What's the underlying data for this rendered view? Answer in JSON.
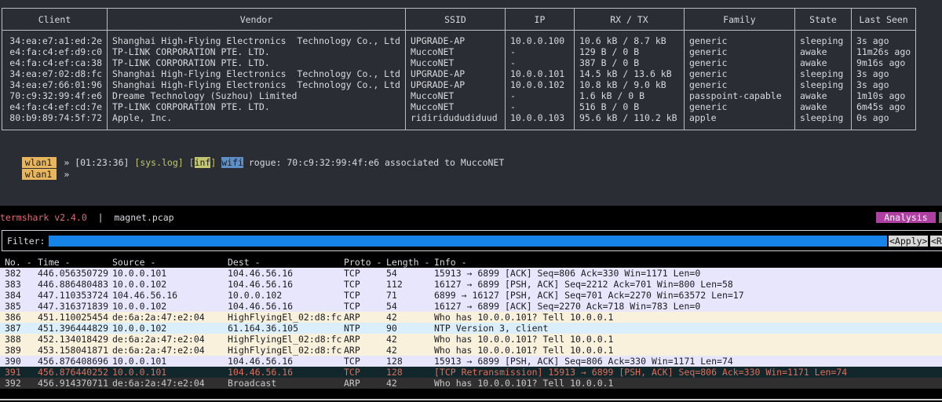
{
  "clients_table": {
    "headers": [
      "Client",
      "Vendor",
      "SSID",
      "IP",
      "RX / TX",
      "Family",
      "State",
      "Last Seen"
    ],
    "rows": [
      [
        "34:ea:e7:a1:ed:2e",
        "Shanghai High-Flying Electronics  Technology Co., Ltd",
        "UPGRADE-AP",
        "10.0.0.100",
        "10.6 kB / 8.7 kB",
        "generic",
        "sleeping",
        "3s ago"
      ],
      [
        "e4:fa:c4:ef:d9:c0",
        "TP-LINK CORPORATION PTE. LTD.",
        "MuccoNET",
        "-",
        "129 B / 0 B",
        "generic",
        "awake",
        "11m26s ago"
      ],
      [
        "e4:fa:c4:ef:ca:38",
        "TP-LINK CORPORATION PTE. LTD.",
        "MuccoNET",
        "-",
        "387 B / 0 B",
        "generic",
        "awake",
        "9m16s ago"
      ],
      [
        "34:ea:e7:02:d8:fc",
        "Shanghai High-Flying Electronics  Technology Co., Ltd",
        "UPGRADE-AP",
        "10.0.0.101",
        "14.5 kB / 13.6 kB",
        "generic",
        "sleeping",
        "3s ago"
      ],
      [
        "34:ea:e7:66:01:96",
        "Shanghai High-Flying Electronics  Technology Co., Ltd",
        "UPGRADE-AP",
        "10.0.0.102",
        "10.8 kB / 9.0 kB",
        "generic",
        "sleeping",
        "3s ago"
      ],
      [
        "70:c9:32:99:4f:e6",
        "Dreame Technology (Suzhou) Limited",
        "MuccoNET",
        "-",
        "1.6 kB / 0 B",
        "passpoint-capable",
        "awake",
        "1m10s ago"
      ],
      [
        "e4:fa:c4:ef:cd:7e",
        "TP-LINK CORPORATION PTE. LTD.",
        "MuccoNET",
        "-",
        "516 B / 0 B",
        "generic",
        "awake",
        "6m45s ago"
      ],
      [
        "80:b9:89:74:5f:72",
        "Apple, Inc.",
        "ridiridududiduud",
        "10.0.0.103",
        "95.6 kB / 110.2 kB",
        "apple",
        "sleeping",
        "0s ago"
      ]
    ]
  },
  "prompt": {
    "iface": "wlan1",
    "chevron": "»",
    "time": "[01:23:36]",
    "syslog_tag": "[sys.log]",
    "bracket_open": "[",
    "level": "inf",
    "bracket_close": "]",
    "module": "wifi",
    "message": "rogue: 70:c9:32:99:4f:e6 associated to MuccoNET"
  },
  "termshark": {
    "app_name": "termshark v2.4.0",
    "separator": "|",
    "file_name": "magnet.pcap",
    "analysis_label": "Analysis",
    "filter_label": "Filter:",
    "filter_value": "",
    "apply_label": "<Apply>",
    "recent_label": "<Recent>",
    "columns": [
      "No. -",
      "Time -",
      "Source -",
      "Dest -",
      "Proto -",
      "Length -",
      "Info -"
    ],
    "packets": [
      {
        "no": "382",
        "time": "446.056350729",
        "src": "10.0.0.101",
        "dst": "104.46.56.16",
        "proto": "TCP",
        "len": "54",
        "info": "15913 → 6899 [ACK] Seq=806 Ack=330 Win=1171 Len=0",
        "kind": "tcp"
      },
      {
        "no": "383",
        "time": "446.886480483",
        "src": "10.0.0.102",
        "dst": "104.46.56.16",
        "proto": "TCP",
        "len": "112",
        "info": "16127 → 6899 [PSH, ACK] Seq=2212 Ack=701 Win=800 Len=58",
        "kind": "tcp"
      },
      {
        "no": "384",
        "time": "447.110353724",
        "src": "104.46.56.16",
        "dst": "10.0.0.102",
        "proto": "TCP",
        "len": "71",
        "info": "6899 → 16127 [PSH, ACK] Seq=701 Ack=2270 Win=63572 Len=17",
        "kind": "tcp"
      },
      {
        "no": "385",
        "time": "447.316371839",
        "src": "10.0.0.102",
        "dst": "104.46.56.16",
        "proto": "TCP",
        "len": "54",
        "info": "16127 → 6899 [ACK] Seq=2270 Ack=718 Win=783 Len=0",
        "kind": "tcp"
      },
      {
        "no": "386",
        "time": "451.110025454",
        "src": "de:6a:2a:47:e2:04",
        "dst": "HighFlyingEl_02:d8:fc",
        "proto": "ARP",
        "len": "42",
        "info": "Who has 10.0.0.101? Tell 10.0.0.1",
        "kind": "arp"
      },
      {
        "no": "387",
        "time": "451.396444829",
        "src": "10.0.0.102",
        "dst": "61.164.36.105",
        "proto": "NTP",
        "len": "90",
        "info": "NTP Version 3, client",
        "kind": "ntp"
      },
      {
        "no": "388",
        "time": "452.134018429",
        "src": "de:6a:2a:47:e2:04",
        "dst": "HighFlyingEl_02:d8:fc",
        "proto": "ARP",
        "len": "42",
        "info": "Who has 10.0.0.101? Tell 10.0.0.1",
        "kind": "arp"
      },
      {
        "no": "389",
        "time": "453.158041871",
        "src": "de:6a:2a:47:e2:04",
        "dst": "HighFlyingEl_02:d8:fc",
        "proto": "ARP",
        "len": "42",
        "info": "Who has 10.0.0.101? Tell 10.0.0.1",
        "kind": "arp"
      },
      {
        "no": "390",
        "time": "456.876408696",
        "src": "10.0.0.101",
        "dst": "104.46.56.16",
        "proto": "TCP",
        "len": "128",
        "info": "15913 → 6899 [PSH, ACK] Seq=806 Ack=330 Win=1171 Len=74",
        "kind": "tcp"
      },
      {
        "no": "391",
        "time": "456.876440252",
        "src": "10.0.0.101",
        "dst": "104.46.56.16",
        "proto": "TCP",
        "len": "128",
        "info": "[TCP Retransmission] 15913 → 6899 [PSH, ACK] Seq=806 Ack=330 Win=1171 Len=74",
        "kind": "bad"
      },
      {
        "no": "392",
        "time": "456.914370711",
        "src": "de:6a:2a:47:e2:04",
        "dst": "Broadcast",
        "proto": "ARP",
        "len": "42",
        "info": "Who has 10.0.0.101? Tell 10.0.0.1",
        "kind": "sel"
      }
    ]
  },
  "colors": {
    "terminal_bg": "#2a2d33",
    "iface_badge": "#e8b65c",
    "analysis_button": "#b03fa3",
    "filter_bar": "#1583e8",
    "tcp_row": "#e7e6fd",
    "arp_row": "#faf1dc",
    "ntp_row": "#daeefc",
    "retransmission_text": "#e06c5a"
  }
}
